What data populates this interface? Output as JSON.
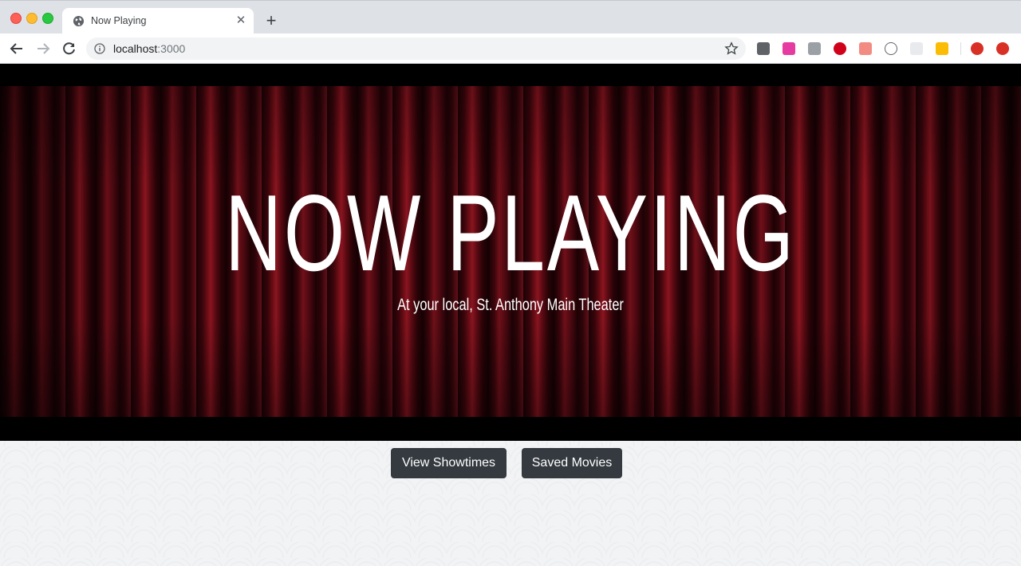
{
  "browser": {
    "tab": {
      "title": "Now Playing",
      "close_glyph": "✕"
    },
    "new_tab_glyph": "+",
    "address": {
      "host": "localhost",
      "port": ":3000"
    },
    "extensions": [
      {
        "name": "dark-ext-icon",
        "color": "#5f6368"
      },
      {
        "name": "grammarly-icon",
        "color": "#e63ba0"
      },
      {
        "name": "font-ext-icon",
        "color": "#9aa0a6"
      },
      {
        "name": "adblock-plus-icon",
        "color": "#d0021b"
      },
      {
        "name": "cast-ext-icon",
        "color": "#f28b82"
      },
      {
        "name": "code-ext-icon",
        "color": "#5f6368"
      },
      {
        "name": "grid-ext-icon",
        "color": "#dadce0"
      },
      {
        "name": "edit-ext-icon",
        "color": "#fbbc04"
      },
      {
        "name": "profile-avatar-icon",
        "color": "#d93025"
      },
      {
        "name": "update-icon",
        "color": "#d93025"
      }
    ]
  },
  "hero": {
    "title": "NOW PLAYING",
    "subtitle": "At your local, St. Anthony Main Theater"
  },
  "actions": {
    "view_showtimes": "View Showtimes",
    "saved_movies": "Saved Movies"
  },
  "colors": {
    "button_bg": "#343a40",
    "curtain": "#6b0d15"
  }
}
